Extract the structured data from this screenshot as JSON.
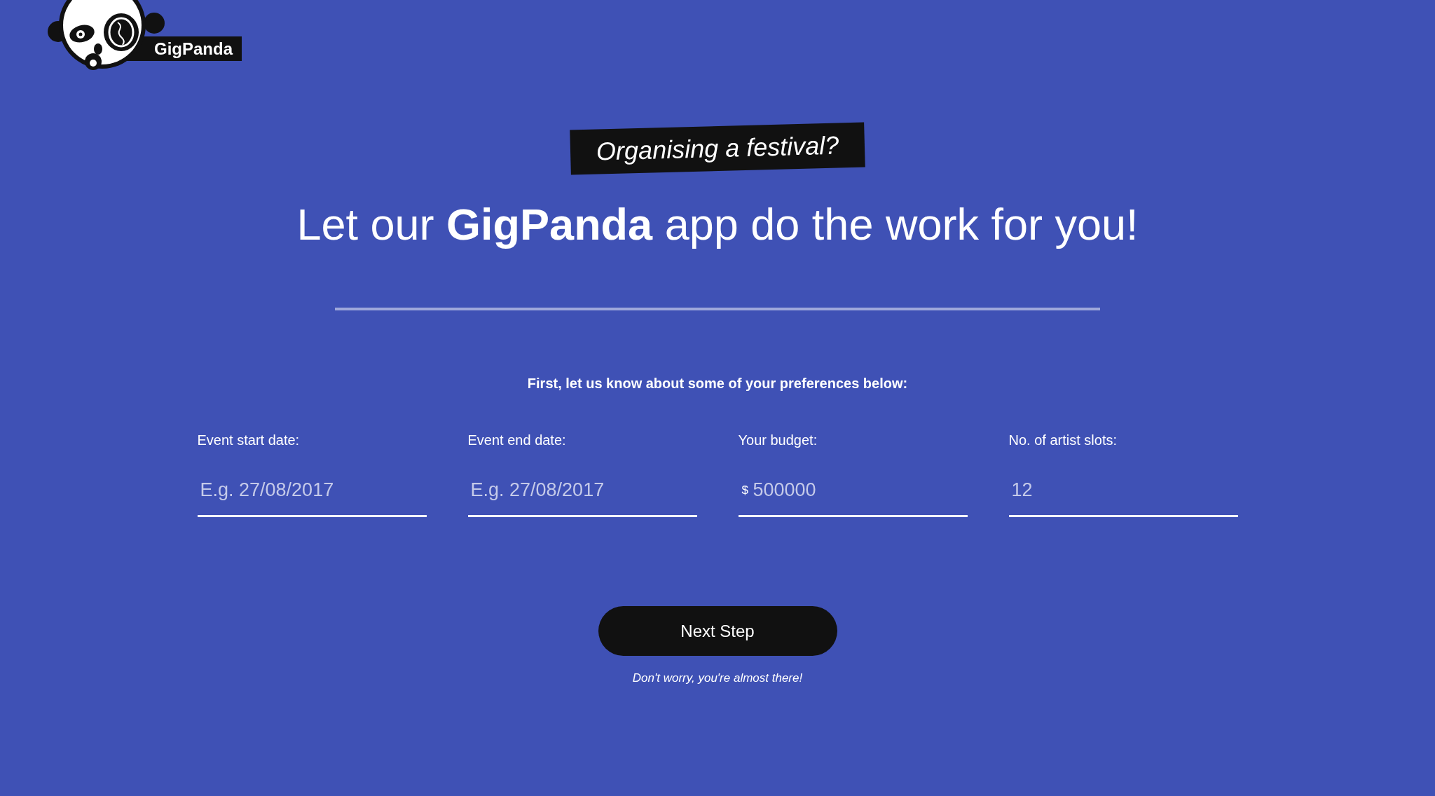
{
  "logo": {
    "brand": "GigPanda"
  },
  "hero": {
    "tagline": "Organising a festival?",
    "headline": "Let our **GigPanda** app do the work for you!"
  },
  "form": {
    "intro": "First, let us know about some of your preferences below:",
    "fields": [
      {
        "label": "Event start date:",
        "placeholder": "E.g. 27/08/2017"
      },
      {
        "label": "Event end date:",
        "placeholder": "E.g. 27/08/2017"
      },
      {
        "label": "Your budget:",
        "prefix": "$",
        "placeholder": "500000"
      },
      {
        "label": "No. of artist slots:",
        "placeholder": "12"
      }
    ]
  },
  "actions": {
    "button": "Next Step",
    "note": "Don't worry, you're almost there!"
  }
}
